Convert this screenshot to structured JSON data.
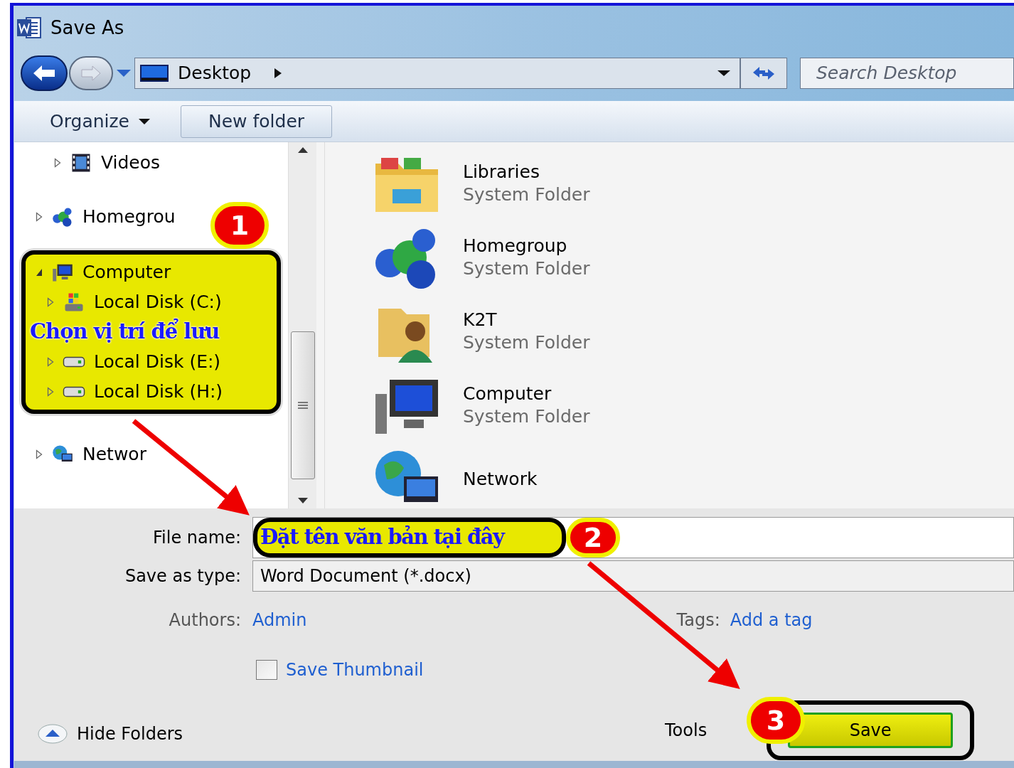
{
  "window": {
    "title": "Save As"
  },
  "address_bar": {
    "location": "Desktop"
  },
  "search": {
    "placeholder": "Search Desktop"
  },
  "toolbar": {
    "organize": "Organize",
    "new_folder": "New folder"
  },
  "nav_tree": [
    {
      "label": "Videos",
      "kind": "videos",
      "expanded": false
    },
    {
      "label": "Homegrou",
      "kind": "homegroup",
      "expanded": false
    },
    {
      "label": "Computer",
      "kind": "computer",
      "expanded": true,
      "highlighted": true,
      "children": [
        {
          "label": "Local Disk (C:)",
          "kind": "system-disk",
          "expanded": false
        },
        {
          "label": "Local Disk (E:)",
          "kind": "disk",
          "expanded": false
        },
        {
          "label": "Local Disk (H:)",
          "kind": "disk",
          "expanded": false
        }
      ]
    },
    {
      "label": "Networ",
      "kind": "network",
      "expanded": false
    }
  ],
  "items": [
    {
      "name": "Libraries",
      "type": "System Folder",
      "kind": "libraries"
    },
    {
      "name": "Homegroup",
      "type": "System Folder",
      "kind": "homegroup"
    },
    {
      "name": "K2T",
      "type": "System Folder",
      "kind": "user"
    },
    {
      "name": "Computer",
      "type": "System Folder",
      "kind": "computer"
    },
    {
      "name": "Network",
      "kind": "network"
    }
  ],
  "form": {
    "file_name_label": "File name:",
    "save_as_type_label": "Save as type:",
    "save_as_type": "Word Document (*.docx)",
    "authors_label": "Authors:",
    "authors": "Admin",
    "tags_label": "Tags:",
    "tags_placeholder": "Add a tag",
    "save_thumbnail": {
      "label": "Save Thumbnail",
      "checked": false
    }
  },
  "footer": {
    "hide_folders": "Hide Folders",
    "tools": "Tools",
    "save": "Save"
  },
  "annotations": {
    "steps": [
      "1",
      "2",
      "3"
    ],
    "location_hint": "Chọn vị trí để lưu",
    "name_hint": "Đặt tên văn bản tại đây"
  }
}
